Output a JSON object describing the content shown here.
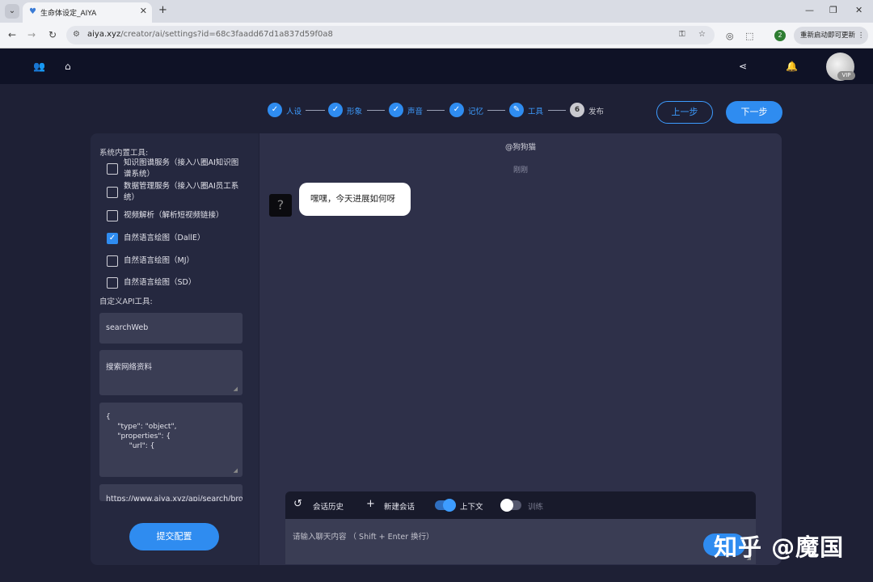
{
  "browser": {
    "tab_title": "生命体设定_AIYA",
    "url_host": "aiya.xyz",
    "url_path": "/creator/ai/settings?id=68c3faadd67d1a837d59f0a8",
    "update_label": "重新启动即可更新",
    "ext_badge": "2"
  },
  "header": {
    "vip": "VIP"
  },
  "steps": [
    {
      "label": "人设",
      "done": true
    },
    {
      "label": "形象",
      "done": true
    },
    {
      "label": "声音",
      "done": true
    },
    {
      "label": "记忆",
      "done": true
    },
    {
      "label": "工具",
      "done": true,
      "icon": "pencil-icon"
    },
    {
      "label": "发布",
      "done": false,
      "number": "6"
    }
  ],
  "nav": {
    "prev": "上一步",
    "next": "下一步"
  },
  "tools": {
    "builtin_title": "系统内置工具:",
    "items": [
      {
        "label": "知识图谱服务（接入八圈AI知识图谱系统）",
        "checked": false
      },
      {
        "label": "数据管理服务（接入八圈AI员工系统）",
        "checked": false
      },
      {
        "label": "视频解析（解析短视频链接）",
        "checked": false
      },
      {
        "label": "自然语言绘图（DallE）",
        "checked": true
      },
      {
        "label": "自然语言绘图（MJ）",
        "checked": false
      },
      {
        "label": "自然语言绘图（SD）",
        "checked": false
      }
    ],
    "custom_title": "自定义API工具:",
    "api_name": "searchWeb",
    "api_desc": "搜索网络资料",
    "api_schema": "{\n     \"type\": \"object\",\n     \"properties\": {\n          \"url\": {",
    "api_url": "https://www.aiya.xyz/api/search/bro",
    "submit": "提交配置"
  },
  "chat": {
    "name": "@狗狗猫",
    "time": "刚刚",
    "avatar_glyph": "?",
    "message": "嘿嘿，今天进展如何呀",
    "history": "会话历史",
    "new_chat": "新建会话",
    "context": "上下文",
    "context_on": true,
    "train": "训练",
    "train_on": false,
    "placeholder": "请输入聊天内容 （ Shift + Enter 换行）"
  },
  "watermark": "知乎 @魔国",
  "colors": {
    "accent": "#2f8cf0",
    "panel": "#25283f",
    "chat_bg": "#2e3049",
    "header": "#0f1226"
  }
}
